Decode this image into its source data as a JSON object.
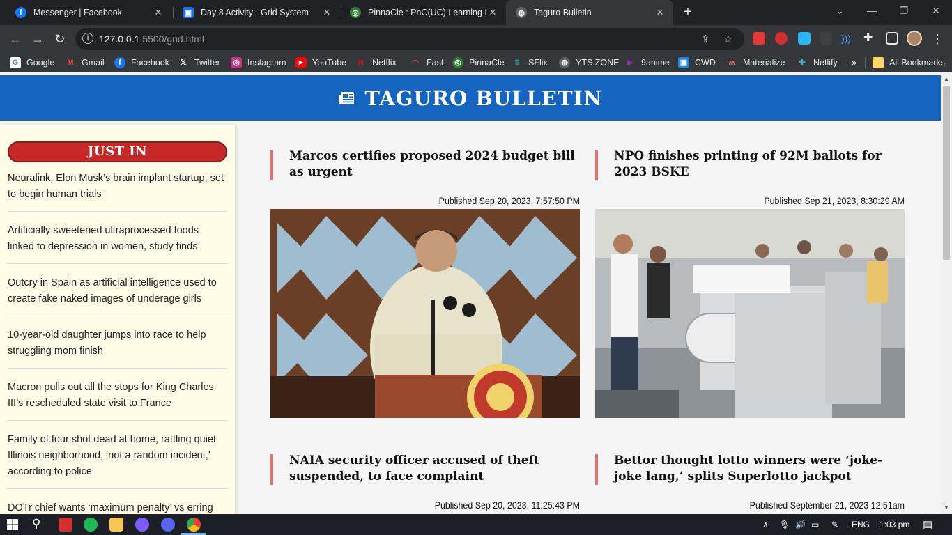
{
  "browser": {
    "tabs": [
      {
        "title": "Messenger | Facebook",
        "icon": "facebook-icon",
        "color": "#1877f2"
      },
      {
        "title": "Day 8 Activity - Grid System",
        "icon": "classroom-icon",
        "color": "#1a73e8"
      },
      {
        "title": "PinnaCle : PnC(UC) Learning Ma",
        "icon": "pinnacle-icon",
        "color": "#2e7d32"
      },
      {
        "title": "Taguro Bulletin",
        "icon": "globe-icon",
        "color": "#9aa0a6"
      }
    ],
    "url_host": "127.0.0.1",
    "url_rest": ":5500/grid.html",
    "bookmarks": [
      {
        "label": "Google",
        "icon": "google-icon"
      },
      {
        "label": "Gmail",
        "icon": "gmail-icon"
      },
      {
        "label": "Facebook",
        "icon": "facebook-icon"
      },
      {
        "label": "Twitter",
        "icon": "x-icon"
      },
      {
        "label": "Instagram",
        "icon": "instagram-icon"
      },
      {
        "label": "YouTube",
        "icon": "youtube-icon"
      },
      {
        "label": "Netflix",
        "icon": "netflix-icon"
      },
      {
        "label": "Fast",
        "icon": "speed-icon"
      },
      {
        "label": "PinnaCle",
        "icon": "pinnacle-icon"
      },
      {
        "label": "SFlix",
        "icon": "sflix-icon"
      },
      {
        "label": "YTS.ZONE",
        "icon": "globe-icon"
      },
      {
        "label": "9anime",
        "icon": "play-icon"
      },
      {
        "label": "CWD",
        "icon": "cwd-icon"
      },
      {
        "label": "Materialize",
        "icon": "materialize-icon"
      },
      {
        "label": "Netlify",
        "icon": "netlify-icon"
      }
    ],
    "bookmarks_overflow": "»",
    "all_bookmarks": "All Bookmarks"
  },
  "site": {
    "brand": "TAGURO BULLETIN",
    "sidebar_title": "JUST IN",
    "just_in": [
      "Neuralink, Elon Musk’s brain implant startup, set to begin human trials",
      "Artificially sweetened ultraprocessed foods linked to depression in women, study finds",
      "Outcry in Spain as artificial intelligence used to create fake naked images of underage girls",
      "10-year-old daughter jumps into race to help struggling mom finish",
      "Macron pulls out all the stops for King Charles III’s rescheduled state visit to France",
      "Family of four shot dead at home, rattling quiet Illinois neighborhood, ‘not a random incident,’ according to police",
      "DOTr chief wants ‘maximum penalty’ vs erring"
    ],
    "articles": [
      {
        "headline": "Marcos certifies proposed 2024 budget bill as urgent",
        "published": "Published Sep 20, 2023, 7:57:50 PM"
      },
      {
        "headline": "NPO finishes printing of 92M ballots for 2023 BSKE",
        "published": "Published Sep 21, 2023, 8:30:29 AM"
      },
      {
        "headline": "NAIA security officer accused of theft suspended, to face complaint",
        "published": "Published Sep 20, 2023, 11:25:43 PM"
      },
      {
        "headline": "Bettor thought lotto winners were ‘joke-joke lang,’ splits Superlotto jackpot",
        "published": "Published September 21, 2023 12:51am"
      }
    ]
  },
  "taskbar": {
    "language": "ENG",
    "time": "1:03 pm"
  }
}
